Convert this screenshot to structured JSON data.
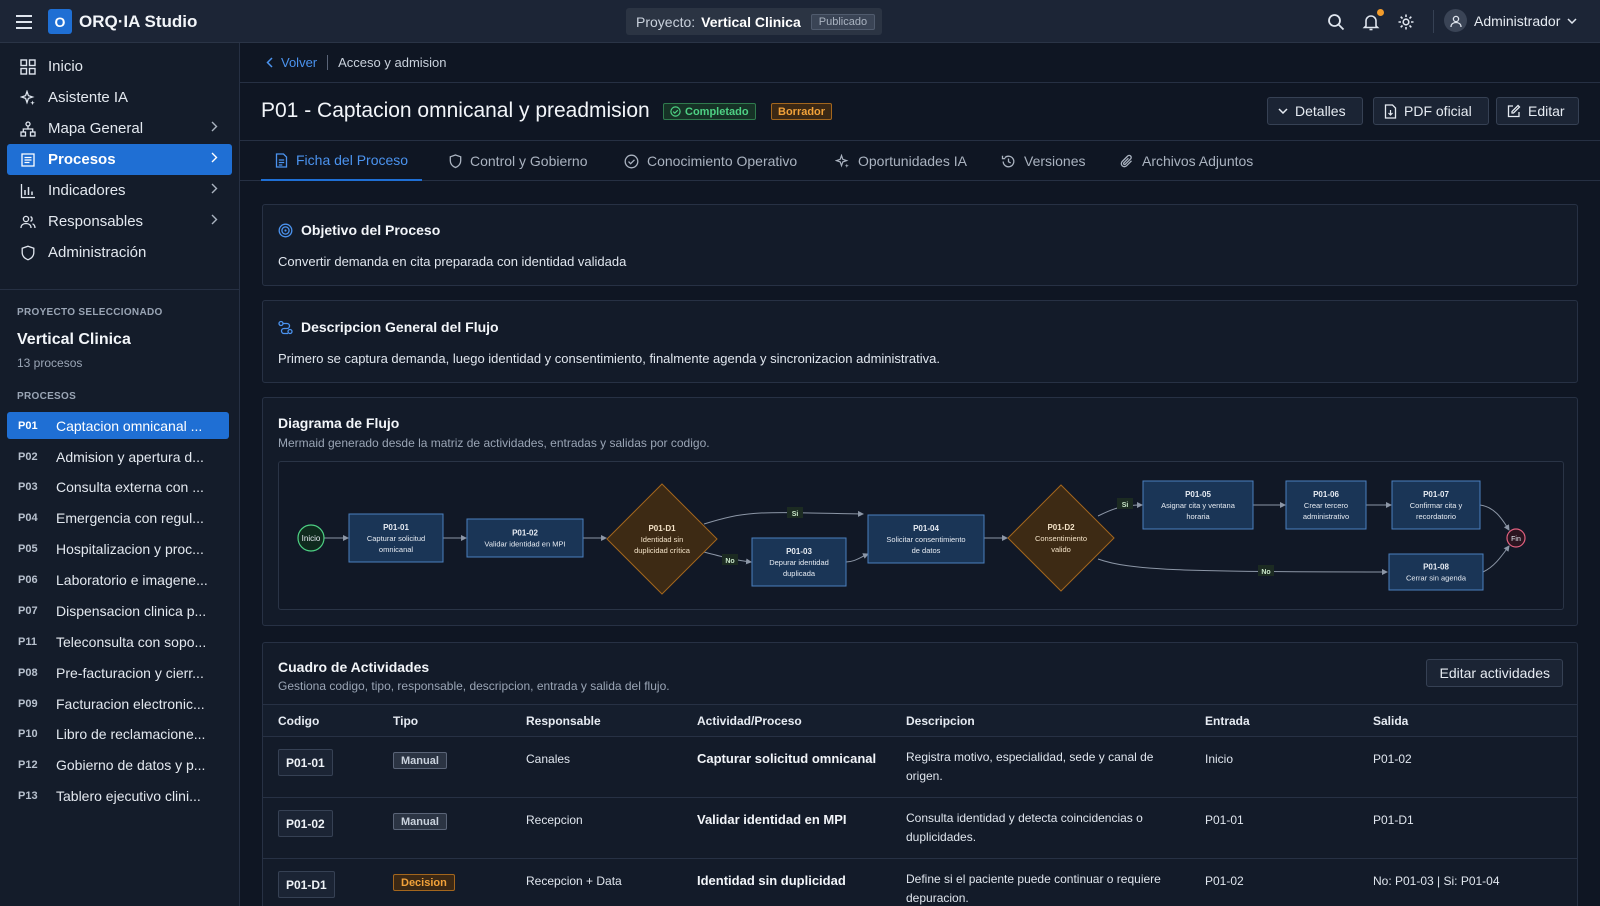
{
  "topbar": {
    "logo_letter": "O",
    "app_title": "ORQ·IA Studio",
    "project_label": "Proyecto:",
    "project_name": "Vertical Clinica",
    "project_status": "Publicado",
    "user_name": "Administrador",
    "icons": [
      "menu-icon",
      "search-icon",
      "bell-icon",
      "gear-icon",
      "user-icon",
      "chevron-down-icon"
    ],
    "notification_dot_color": "#f39c2b"
  },
  "sidebar": {
    "nav": [
      {
        "label": "Inicio",
        "icon": "grid-icon"
      },
      {
        "label": "Asistente IA",
        "icon": "sparkle-icon"
      },
      {
        "label": "Mapa General",
        "icon": "hierarchy-icon"
      },
      {
        "label": "Procesos",
        "icon": "document-icon",
        "active": true
      },
      {
        "label": "Indicadores",
        "icon": "bar-chart-icon"
      },
      {
        "label": "Responsables",
        "icon": "users-icon"
      },
      {
        "label": "Administración",
        "icon": "shield-icon"
      }
    ],
    "selected_caption": "PROYECTO SELECCIONADO",
    "project_name": "Vertical Clinica",
    "project_count": "13 procesos",
    "processes_caption": "PROCESOS",
    "processes": [
      {
        "code": "P01",
        "name": "Captacion omnicanal ...",
        "active": true
      },
      {
        "code": "P02",
        "name": "Admision y apertura d..."
      },
      {
        "code": "P03",
        "name": "Consulta externa con ..."
      },
      {
        "code": "P04",
        "name": "Emergencia con regul..."
      },
      {
        "code": "P05",
        "name": "Hospitalizacion y proc..."
      },
      {
        "code": "P06",
        "name": "Laboratorio e imagene..."
      },
      {
        "code": "P07",
        "name": "Dispensacion clinica p..."
      },
      {
        "code": "P11",
        "name": "Teleconsulta con sopo..."
      },
      {
        "code": "P08",
        "name": "Pre-facturacion y cierr..."
      },
      {
        "code": "P09",
        "name": "Facturacion electronic..."
      },
      {
        "code": "P10",
        "name": "Libro de reclamacione..."
      },
      {
        "code": "P12",
        "name": "Gobierno de datos y p..."
      },
      {
        "code": "P13",
        "name": "Tablero ejecutivo clini..."
      }
    ]
  },
  "breadcrumb": {
    "back": "Volver",
    "current": "Acceso y admision"
  },
  "header": {
    "title": "P01 - Captacion omnicanal y preadmision",
    "status_badge": "Completado",
    "draft_badge": "Borrador",
    "buttons": {
      "details": "Detalles",
      "pdf": "PDF oficial",
      "edit": "Editar"
    }
  },
  "tabs": [
    {
      "label": "Ficha del Proceso",
      "icon": "document-icon",
      "active": true
    },
    {
      "label": "Control y Gobierno",
      "icon": "shield-icon"
    },
    {
      "label": "Conocimiento Operativo",
      "icon": "check-circle-icon"
    },
    {
      "label": "Oportunidades IA",
      "icon": "sparkle-icon"
    },
    {
      "label": "Versiones",
      "icon": "history-icon"
    },
    {
      "label": "Archivos Adjuntos",
      "icon": "paperclip-icon"
    }
  ],
  "objective": {
    "title": "Objetivo del Proceso",
    "text": "Convertir demanda en cita preparada con identidad validada"
  },
  "description": {
    "title": "Descripcion General del Flujo",
    "text": "Primero se captura demanda, luego identidad y consentimiento, finalmente agenda y sincronizacion administrativa."
  },
  "diagram": {
    "title": "Diagrama de Flujo",
    "subtitle": "Mermaid generado desde la matriz de actividades, entradas y salidas por codigo.",
    "start": "Inicio",
    "end": "Fin",
    "nodes": [
      {
        "code": "P01-01",
        "label": [
          "Capturar solicitud",
          "omnicanal"
        ],
        "kind": "task"
      },
      {
        "code": "P01-02",
        "label": [
          "Validar identidad en MPI"
        ],
        "kind": "task"
      },
      {
        "code": "P01-D1",
        "label": [
          "Identidad sin",
          "duplicidad crítica"
        ],
        "kind": "decision"
      },
      {
        "code": "P01-03",
        "label": [
          "Depurar identidad",
          "duplicada"
        ],
        "kind": "task"
      },
      {
        "code": "P01-04",
        "label": [
          "Solicitar consentimiento",
          "de datos"
        ],
        "kind": "task"
      },
      {
        "code": "P01-D2",
        "label": [
          "Consentimiento",
          "valido"
        ],
        "kind": "decision"
      },
      {
        "code": "P01-05",
        "label": [
          "Asignar cita y ventana",
          "horaria"
        ],
        "kind": "task"
      },
      {
        "code": "P01-06",
        "label": [
          "Crear tercero",
          "administrativo"
        ],
        "kind": "task"
      },
      {
        "code": "P01-07",
        "label": [
          "Confirmar cita y",
          "recordatorio"
        ],
        "kind": "task"
      },
      {
        "code": "P01-08",
        "label": [
          "Cerrar sin agenda"
        ],
        "kind": "task"
      }
    ],
    "edge_labels": {
      "yes": "Si",
      "no": "No"
    },
    "colors": {
      "task_fill": "#1a3556",
      "task_stroke": "#4a7fbf",
      "decision_fill": "#3d2a14",
      "decision_stroke": "#a3661d",
      "start_stroke": "#4ed184",
      "end_stroke": "#e0607e"
    }
  },
  "activities": {
    "title": "Cuadro de Actividades",
    "subtitle": "Gestiona codigo, tipo, responsable, descripcion, entrada y salida del flujo.",
    "edit_button": "Editar actividades",
    "columns": [
      "Codigo",
      "Tipo",
      "Responsable",
      "Actividad/Proceso",
      "Descripcion",
      "Entrada",
      "Salida"
    ],
    "rows": [
      {
        "code": "P01-01",
        "type": "Manual",
        "responsible": "Canales",
        "activity": "Capturar solicitud omnicanal",
        "description": [
          "Registra motivo, especialidad, sede y canal de",
          "origen."
        ],
        "input": "Inicio",
        "output": "P01-02"
      },
      {
        "code": "P01-02",
        "type": "Manual",
        "responsible": "Recepcion",
        "activity": "Validar identidad en MPI",
        "description": [
          "Consulta identidad y detecta coincidencias o",
          "duplicidades."
        ],
        "input": "P01-01",
        "output": "P01-D1"
      },
      {
        "code": "P01-D1",
        "type": "Decision",
        "responsible": "Recepcion + Data",
        "activity": "Identidad sin duplicidad",
        "description": [
          "Define si el paciente puede continuar o requiere",
          "depuracion."
        ],
        "input": "P01-02",
        "output": "No: P01-03 | Si: P01-04"
      }
    ]
  }
}
